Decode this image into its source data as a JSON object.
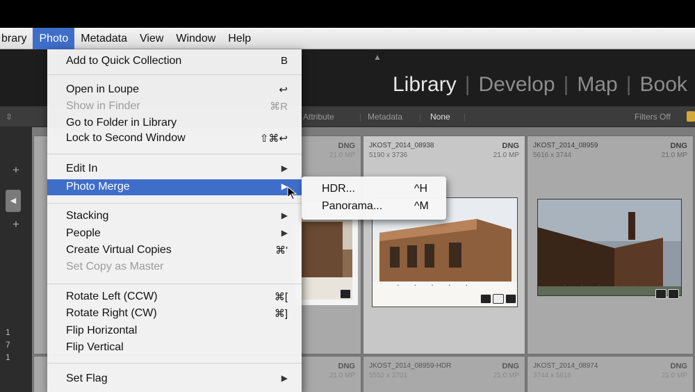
{
  "menubar": {
    "items": [
      "brary",
      "Photo",
      "Metadata",
      "View",
      "Window",
      "Help"
    ]
  },
  "modules": {
    "current": "Library",
    "others": [
      "Develop",
      "Map",
      "Book"
    ]
  },
  "filterbar": {
    "attribute": "Attribute",
    "metadata": "Metadata",
    "none": "None",
    "filters": "Filters Off"
  },
  "grid": {
    "cells": [
      {
        "filename": "",
        "type": "DNG",
        "dims": "",
        "mp": "21.0 MP"
      },
      {
        "filename": "JKOST_2014_08938",
        "type": "DNG",
        "dims": "5190 x 3736",
        "mp": "21.0 MP"
      },
      {
        "filename": "JKOST_2014_08959",
        "type": "DNG",
        "dims": "5616 x 3744",
        "mp": "21.0 MP"
      },
      {
        "filename": "",
        "type": "DNG",
        "dims": "",
        "mp": "21.0 MP"
      },
      {
        "filename": "JKOST_2014_08959-HDR",
        "type": "DNG",
        "dims": "5552 x 3701",
        "mp": "21.0 MP"
      },
      {
        "filename": "JKOST_2014_08974",
        "type": "DNG",
        "dims": "3744 x 5616",
        "mp": "21.0 MP"
      }
    ],
    "dots": ". . . . ."
  },
  "left_strip": {
    "plus": "+",
    "numbers": [
      "1",
      "7",
      "1"
    ]
  },
  "photo_menu": {
    "items": [
      {
        "label": "Add to Quick Collection",
        "shortcut": "B"
      },
      {
        "label": "Open in Loupe",
        "shortcut": "↩"
      },
      {
        "label": "Show in Finder",
        "shortcut": "⌘R"
      },
      {
        "label": "Go to Folder in Library",
        "shortcut": ""
      },
      {
        "label": "Lock to Second Window",
        "shortcut": "⇧⌘↩"
      },
      {
        "label": "Edit In",
        "shortcut": "▶"
      },
      {
        "label": "Photo Merge",
        "shortcut": "▶"
      },
      {
        "label": "Stacking",
        "shortcut": "▶"
      },
      {
        "label": "People",
        "shortcut": "▶"
      },
      {
        "label": "Create Virtual Copies",
        "shortcut": "⌘'"
      },
      {
        "label": "Set Copy as Master",
        "shortcut": ""
      },
      {
        "label": "Rotate Left (CCW)",
        "shortcut": "⌘["
      },
      {
        "label": "Rotate Right (CW)",
        "shortcut": "⌘]"
      },
      {
        "label": "Flip Horizontal",
        "shortcut": ""
      },
      {
        "label": "Flip Vertical",
        "shortcut": ""
      },
      {
        "label": "Set Flag",
        "shortcut": "▶"
      }
    ]
  },
  "submenu": {
    "items": [
      {
        "label": "HDR...",
        "shortcut": "^H"
      },
      {
        "label": "Panorama...",
        "shortcut": "^M"
      }
    ]
  },
  "colors": {
    "highlight": "#3f6ec9",
    "menu_bg": "#f4f4f4",
    "app_dark": "#1d1d1d",
    "grid_bg": "#7b7b7b"
  }
}
